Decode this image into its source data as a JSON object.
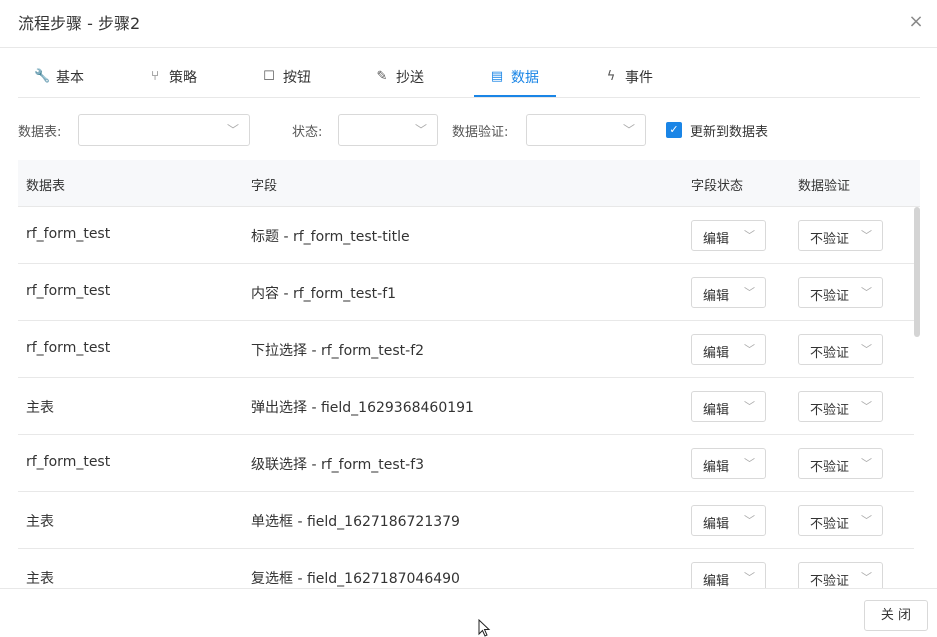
{
  "dialog": {
    "title": "流程步骤 - 步骤2",
    "close_icon": "×"
  },
  "tabs": [
    {
      "label": "基本",
      "icon": "wrench-icon",
      "glyph": "🔧"
    },
    {
      "label": "策略",
      "icon": "branch-icon",
      "glyph": "⑂"
    },
    {
      "label": "按钮",
      "icon": "square-icon",
      "glyph": "☐"
    },
    {
      "label": "抄送",
      "icon": "edit-icon",
      "glyph": "✎"
    },
    {
      "label": "数据",
      "icon": "table-icon",
      "glyph": "▤"
    },
    {
      "label": "事件",
      "icon": "bolt-icon",
      "glyph": "ϟ"
    }
  ],
  "active_tab": "数据",
  "filters": {
    "table_label": "数据表:",
    "status_label": "状态:",
    "validation_label": "数据验证:",
    "table_value": "",
    "status_value": "",
    "validation_value": "",
    "update_checkbox_label": "更新到数据表",
    "update_checked": true
  },
  "table": {
    "headers": [
      "数据表",
      "字段",
      "字段状态",
      "数据验证"
    ],
    "rows": [
      {
        "table": "rf_form_test",
        "field": "标题 - rf_form_test-title",
        "status": "编辑",
        "validation": "不验证"
      },
      {
        "table": "rf_form_test",
        "field": "内容 - rf_form_test-f1",
        "status": "编辑",
        "validation": "不验证"
      },
      {
        "table": "rf_form_test",
        "field": "下拉选择 - rf_form_test-f2",
        "status": "编辑",
        "validation": "不验证"
      },
      {
        "table": "主表",
        "field": "弹出选择 - field_1629368460191",
        "status": "编辑",
        "validation": "不验证"
      },
      {
        "table": "rf_form_test",
        "field": "级联选择 - rf_form_test-f3",
        "status": "编辑",
        "validation": "不验证"
      },
      {
        "table": "主表",
        "field": "单选框 - field_1627186721379",
        "status": "编辑",
        "validation": "不验证"
      },
      {
        "table": "主表",
        "field": "复选框 - field_1627187046490",
        "status": "编辑",
        "validation": "不验证"
      }
    ]
  },
  "footer": {
    "close_label": "关 闭"
  },
  "colors": {
    "accent": "#1a85e6"
  }
}
